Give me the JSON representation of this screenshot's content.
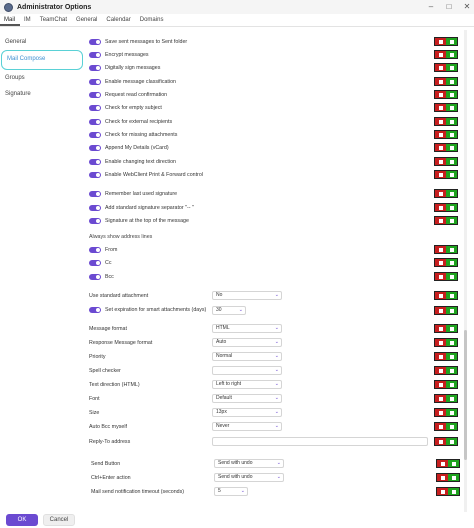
{
  "window": {
    "title": "Administrator Options"
  },
  "tabs": [
    "Mail",
    "IM",
    "TeamChat",
    "General",
    "Calendar",
    "Domains"
  ],
  "sidebar": {
    "items": [
      "General",
      "Mail Compose",
      "Groups",
      "Signature"
    ]
  },
  "toggles": {
    "t0": "Save sent messages to Sent folder",
    "t1": "Encrypt messages",
    "t2": "Digitally sign messages",
    "t3": "Enable message classification",
    "t4": "Request read confirmation",
    "t5": "Check for empty subject",
    "t6": "Check for external recipients",
    "t7": "Check for missing attachments",
    "t8": "Append My Details (vCard)",
    "t9": "Enable changing text direction",
    "t10": "Enable WebClient Print & Forward control",
    "t11": "Remember last used signature",
    "t12": "Add standard signature separator \"-- \"",
    "t13": "Signature at the top of the message",
    "t14": "From",
    "t15": "Cc",
    "t16": "Bcc",
    "t17": "Set expiration for smart attachments (days)"
  },
  "labels": {
    "always_show": "Always show address lines",
    "use_std_attachment": "Use standard attachment",
    "message_format": "Message format",
    "response_format": "Response Message format",
    "priority": "Priority",
    "spell_checker": "Spell checker",
    "text_direction": "Text direction (HTML)",
    "font": "Font",
    "size": "Size",
    "auto_bcc": "Auto Bcc myself",
    "reply_to": "Reply-To address",
    "send_button": "Send Button",
    "ctrl_enter": "Ctrl+Enter action",
    "send_timeout": "Mail send notification timeout (seconds)"
  },
  "values": {
    "use_std_attachment": "No",
    "expiration_days": "30",
    "message_format": "HTML",
    "response_format": "Auto",
    "priority": "Normal",
    "spell_checker": "",
    "text_direction": "Left to right",
    "font": "Default",
    "size": "13px",
    "auto_bcc": "Never",
    "reply_to": "",
    "send_button": "Send with undo",
    "ctrl_enter": "Send with undo",
    "send_timeout": "5"
  },
  "footer": {
    "ok": "OK",
    "cancel": "Cancel"
  },
  "colors": {
    "accent": "#6b4ad1",
    "deny": "#c71f1f",
    "allow": "#1fa31f",
    "focus": "#5ad1d6"
  }
}
